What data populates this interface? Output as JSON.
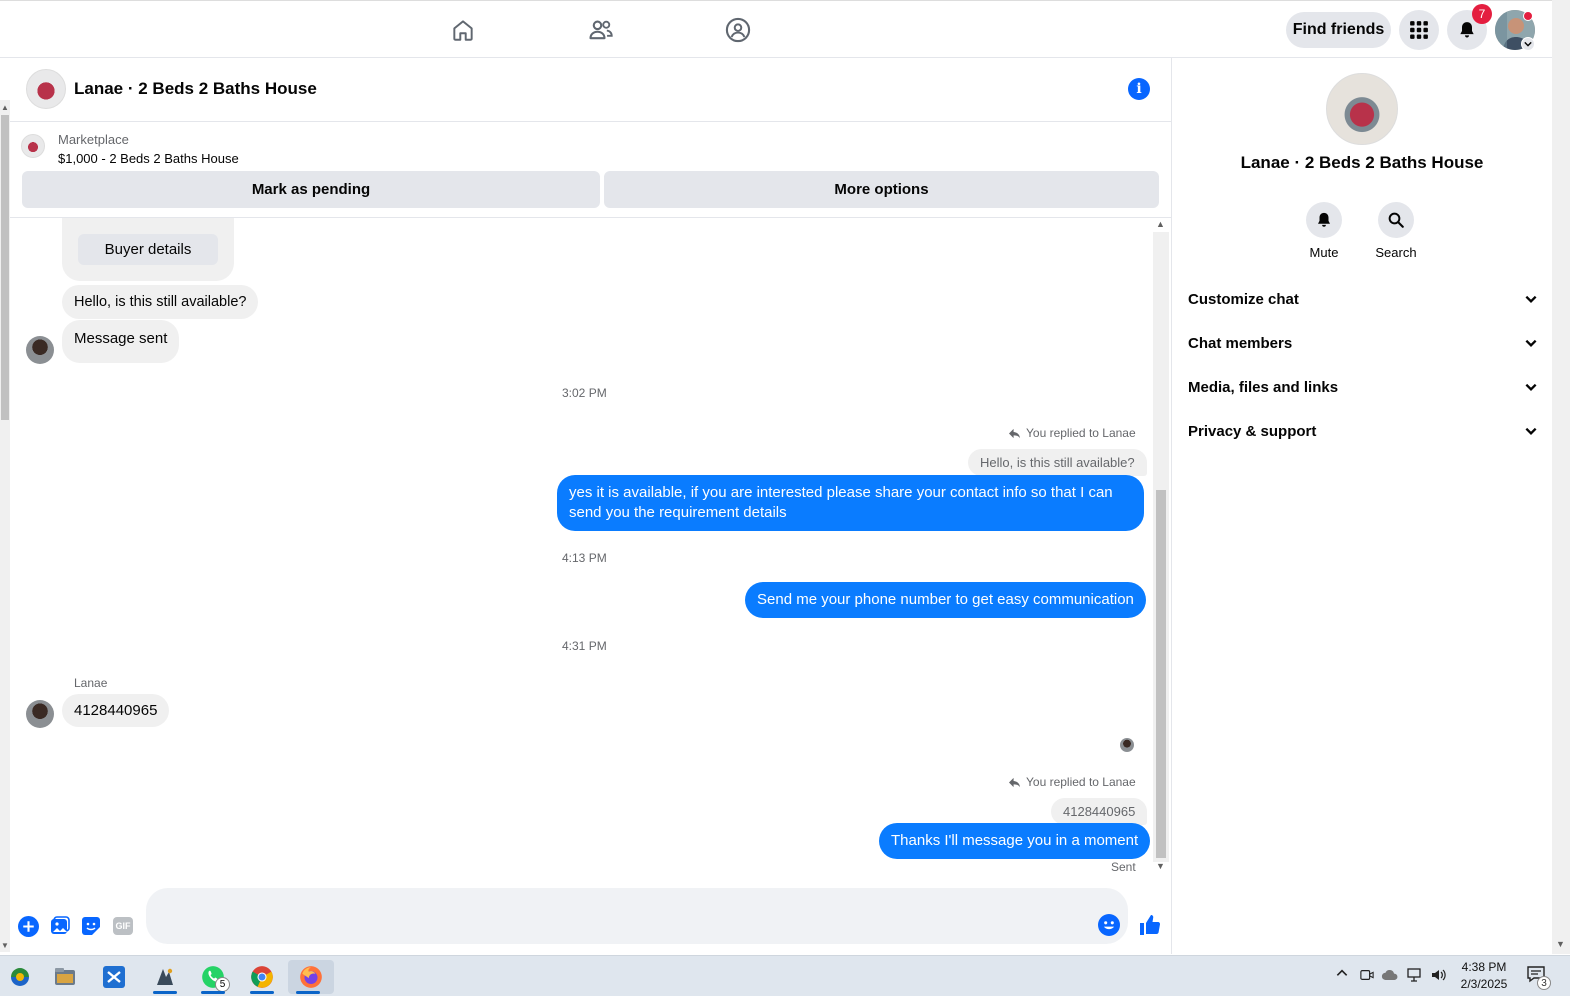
{
  "topbar": {
    "nav_icons": [
      "home-icon",
      "friends-icon",
      "groups-icon"
    ],
    "find_friends_label": "Find friends",
    "notifications_count": "7"
  },
  "chat": {
    "title": "Lanae · 2 Beds 2 Baths House",
    "marketplace": {
      "label": "Marketplace",
      "listing": "$1,000 - 2 Beds 2 Baths House",
      "mark_pending_label": "Mark as pending",
      "more_options_label": "More options"
    },
    "buyer_details_label": "Buyer details",
    "messages": {
      "in_1": "Hello, is this still available?",
      "in_2": "Message sent",
      "time_1": "3:02 PM",
      "reply_note_1": "You replied to Lanae",
      "quote_1": "Hello, is this still available?",
      "out_1": "yes it is available, if you are interested please share your contact info so that I can send you the requirement details",
      "time_2": "4:13 PM",
      "out_2": "Send me your phone number to get easy communication",
      "time_3": "4:31 PM",
      "sender_name": "Lanae",
      "in_3": "4128440965",
      "reply_note_2": "You replied to Lanae",
      "quote_2": "4128440965",
      "out_3": "Thanks I'll message you in a moment",
      "status": "Sent"
    },
    "composer": {
      "placeholder": "",
      "icons": [
        "plus-icon",
        "image-icon",
        "sticker-icon",
        "gif-icon",
        "emoji-icon",
        "like-icon"
      ],
      "gif_label": "GIF"
    }
  },
  "details": {
    "title": "Lanae · 2 Beds 2 Baths House",
    "mute_label": "Mute",
    "search_label": "Search",
    "sections": [
      "Customize chat",
      "Chat members",
      "Media, files and links",
      "Privacy & support"
    ]
  },
  "taskbar": {
    "apps": [
      "windows-icon",
      "file-explorer-icon",
      "vscode-icon",
      "app-icon",
      "whatsapp-icon",
      "chrome-icon",
      "firefox-icon"
    ],
    "whatsapp_badge": "5",
    "time": "4:38 PM",
    "date": "2/3/2025",
    "notification_count": "3"
  },
  "colors": {
    "accent": "#0866ff",
    "outgoing_bubble": "#0a7cff",
    "incoming_bubble": "#f0f0f0",
    "badge": "#e41e3f"
  }
}
